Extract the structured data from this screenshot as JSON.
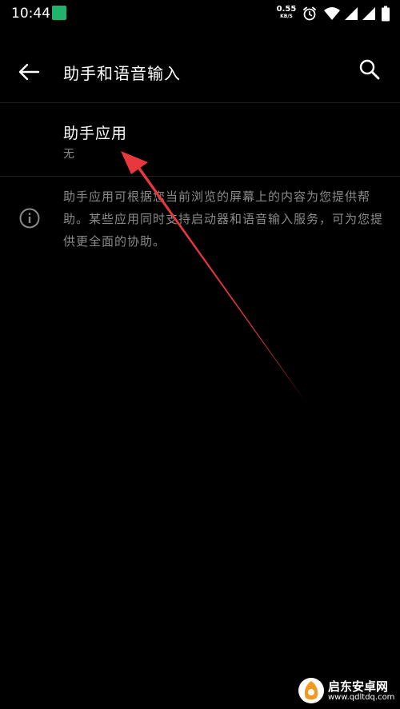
{
  "status_bar": {
    "time": "10:44",
    "net_speed_value": "0.55",
    "net_speed_unit": "KB/S",
    "notification_icon": "app-notification-icon",
    "icons": [
      "alarm-icon",
      "wifi-icon",
      "signal-icon",
      "signal-icon",
      "battery-icon"
    ]
  },
  "toolbar": {
    "title": "助手和语音输入",
    "back_icon": "arrow-back-icon",
    "search_icon": "search-icon"
  },
  "assistant_app": {
    "title": "助手应用",
    "summary": "无"
  },
  "info": {
    "icon": "info-icon",
    "text": "助手应用可根据您当前浏览的屏幕上的内容为您提供帮助。某些应用同时支持启动器和语音输入服务，可为您提供更全面的协助。"
  },
  "watermark": {
    "name": "启东安卓网",
    "url": "www.qdltdq.com"
  },
  "colors": {
    "background": "#000000",
    "primary_text": "#ffffff",
    "secondary_text": "#8a8a8a",
    "annotation_arrow": "#e8383d"
  }
}
